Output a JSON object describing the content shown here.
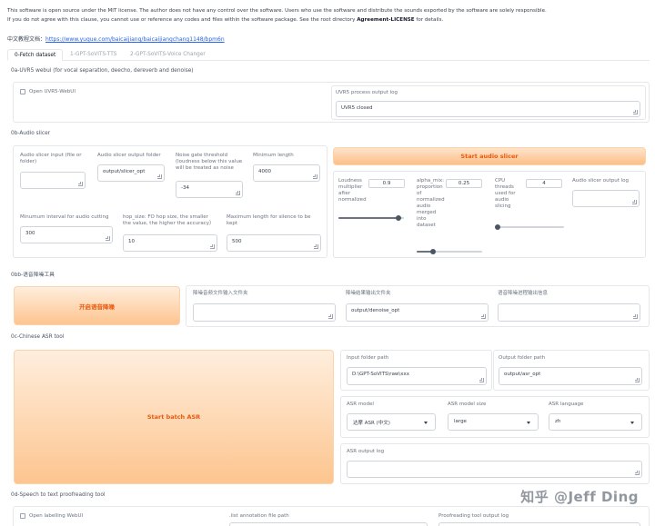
{
  "license": {
    "line1": "This software is open source under the MIT license. The author does not have any control over the software. Users who use the software and distribute the sounds exported by the software are solely responsible.",
    "line2_pre": "If you do not agree with this clause, you cannot use or reference any codes and files within the software package. See the root directory ",
    "line2_bold": "Agreement-LICENSE",
    "line2_post": " for details."
  },
  "doc": {
    "label": "中文教程文档：",
    "url": "https://www.yuque.com/baicaijiang/baicaijiangchang1148/bpm6n"
  },
  "tabs": [
    "0-Fetch dataset",
    "1-GPT-SoVITS-TTS",
    "2-GPT-SoVITS-Voice Changer"
  ],
  "uvr": {
    "title": "0a-UVR5 webui (for vocal separation, deecho, dereverb and denoise)",
    "checkbox_label": "Open UVR5-WebUI",
    "log_label": "UVR5 process output log",
    "log_value": "UVR5 closed"
  },
  "slicer": {
    "title": "0b-Audio slicer",
    "input_label": "Audio slicer input (file or folder)",
    "input_value": "",
    "output_label": "Audio slicer output folder",
    "output_value": "output/slicer_opt",
    "threshold_label": "Noise gate threshold (loudness below this value will be treated as noise",
    "threshold_value": "-34",
    "minlen_label": "Minimum length",
    "minlen_value": "4000",
    "interval_label": "Minumum interval for audio cutting",
    "interval_value": "300",
    "hop_label": "hop_size: FO hop size, the smaller the value, the higher the accuracy）",
    "hop_value": "10",
    "maxsil_label": "Maximum length for silence to be kept",
    "maxsil_value": "500",
    "start_button": "Start audio slicer",
    "loudness_label": "Loudness multiplier after normalized",
    "loudness_value": 0.9,
    "alpha_label": "alpha_mix: proportion of normalized audio merged into dataset",
    "alpha_value": 0.25,
    "threads_label": "CPU threads used for audio slicing",
    "threads_value": 4,
    "log_label": "Audio slicer output log",
    "log_value": ""
  },
  "denoise": {
    "title": "0bb-语音降噪工具",
    "button": "开启语音降噪",
    "input_label": "降噪音频文件输入文件夹",
    "input_value": "",
    "output_label": "降噪结果输出文件夹",
    "output_value": "output/denoise_opt",
    "log_label": "语音降噪进程输出信息",
    "log_value": ""
  },
  "asr": {
    "title": "0c-Chinese ASR tool",
    "button": "Start batch ASR",
    "input_label": "Input folder path",
    "input_value": "D:\\GPT-SoVITS\\raw\\xxx",
    "output_label": "Output folder path",
    "output_value": "output/asr_opt",
    "model_label": "ASR model",
    "model_value": "达摩 ASR (中文)",
    "size_label": "ASR model size",
    "size_value": "large",
    "lang_label": "ASR language",
    "lang_value": "zh",
    "log_label": "ASR output log",
    "log_value": ""
  },
  "proof": {
    "title": "0d-Speech to text proofreading tool",
    "checkbox_label": "Open labelling WebUI",
    "list_label": ".list annotation file path",
    "log_label": "Proofreading tool output log"
  },
  "watermark": "知乎 @Jeff Ding"
}
